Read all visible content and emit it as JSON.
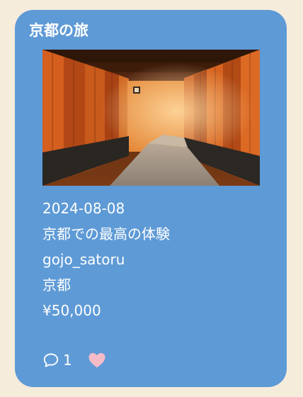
{
  "post": {
    "title": "京都の旅",
    "date": "2024-08-08",
    "headline": "京都での最高の体験",
    "author": "gojo_satoru",
    "location": "京都",
    "price": "¥50,000",
    "comment_count": "1",
    "liked": true
  },
  "icons": {
    "comment": "speech-bubble-icon",
    "like": "heart-icon"
  },
  "colors": {
    "page_background": "#f6ecdc",
    "card_background": "#5e9ad6",
    "text": "#ffffff",
    "like_active": "#f4bcc8"
  }
}
